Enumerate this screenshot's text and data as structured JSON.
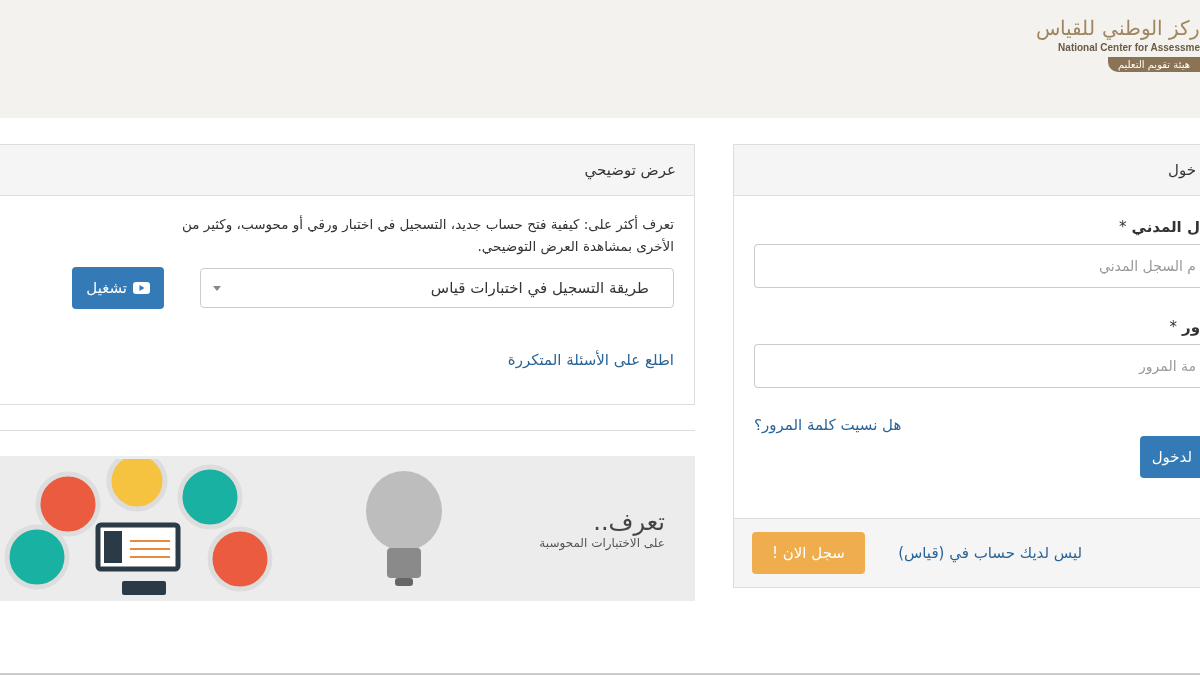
{
  "header": {
    "logo_arabic": "ركز الوطني للقياس",
    "logo_english": "National Center for Assessme",
    "logo_ribbon": "هيئة تقويم التعليم"
  },
  "login_panel": {
    "title": "خول",
    "fields": [
      {
        "label": "ل المدني",
        "mark": "*",
        "placeholder": "م السجل المدني"
      },
      {
        "label": "ور",
        "mark": "*",
        "placeholder": "مة المرور"
      }
    ],
    "forgot_link": "هل نسيت كلمة المرور؟",
    "login_button": "لدخول",
    "footer_text": "ليس لديك حساب في (قياس)",
    "register_button": "سجل الان !"
  },
  "demo_panel": {
    "title": "عرض توضيحي",
    "description": "تعرف أكثر على: كيفية فتح حساب جديد، التسجيل في اختبار ورقي أو محوسب، وكثير من\nالأخرى بمشاهدة العرض التوضيحي.",
    "select_value": "طريقة التسجيل في اختبارات قياس",
    "play_button": "تشغيل",
    "faq_link": "اطلع على الأسئلة المتكررة"
  },
  "banner": {
    "title": "تعرف..",
    "subtitle": "على الاختبارات المحوسبة"
  }
}
